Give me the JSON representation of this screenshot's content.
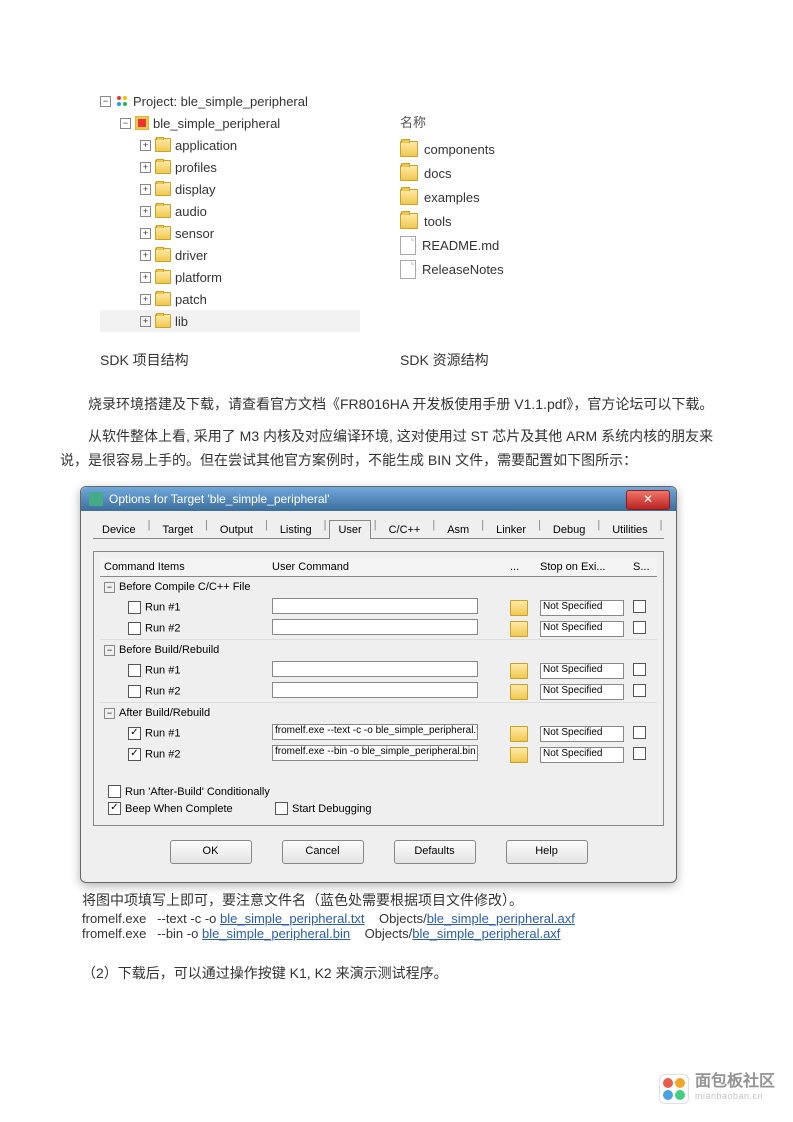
{
  "tree": {
    "root_label": "Project: ble_simple_peripheral",
    "target_label": "ble_simple_peripheral",
    "folders": [
      "application",
      "profiles",
      "display",
      "audio",
      "sensor",
      "driver",
      "platform",
      "patch",
      "lib"
    ]
  },
  "file_list": {
    "header": "名称",
    "folders": [
      "components",
      "docs",
      "examples",
      "tools"
    ],
    "files": [
      "README.md",
      "ReleaseNotes"
    ]
  },
  "captions": {
    "left": "SDK 项目结构",
    "right": "SDK 资源结构"
  },
  "paragraphs": {
    "p1": "烧录环境搭建及下载，请查看官方文档《FR8016HA 开发板使用手册 V1.1.pdf》，官方论坛可以下载。",
    "p2": "从软件整体上看, 采用了 M3 内核及对应编译环境, 这对使用过 ST 芯片及其他 ARM 系统内核的朋友来说，是很容易上手的。但在尝试其他官方案例时，不能生成 BIN 文件，需要配置如下图所示："
  },
  "dialog": {
    "title": "Options for Target 'ble_simple_peripheral'",
    "tabs": [
      "Device",
      "Target",
      "Output",
      "Listing",
      "User",
      "C/C++",
      "Asm",
      "Linker",
      "Debug",
      "Utilities"
    ],
    "active_tab": 4,
    "headers": {
      "items": "Command Items",
      "cmd": "User Command",
      "dots": "...",
      "stop": "Stop on Exi...",
      "s": "S..."
    },
    "groups": [
      {
        "label": "Before Compile C/C++ File",
        "rows": [
          {
            "checked": false,
            "label": "Run #1",
            "cmd": "",
            "stop": "Not Specified"
          },
          {
            "checked": false,
            "label": "Run #2",
            "cmd": "",
            "stop": "Not Specified"
          }
        ]
      },
      {
        "label": "Before Build/Rebuild",
        "rows": [
          {
            "checked": false,
            "label": "Run #1",
            "cmd": "",
            "stop": "Not Specified"
          },
          {
            "checked": false,
            "label": "Run #2",
            "cmd": "",
            "stop": "Not Specified"
          }
        ]
      },
      {
        "label": "After Build/Rebuild",
        "rows": [
          {
            "checked": true,
            "label": "Run #1",
            "cmd": "fromelf.exe  --text  -c -o ble_simple_peripheral.tx...",
            "stop": "Not Specified"
          },
          {
            "checked": true,
            "label": "Run #2",
            "cmd": "fromelf.exe  --bin -o ble_simple_peripheral.bin ...",
            "stop": "Not Specified"
          }
        ]
      }
    ],
    "opts": {
      "run_after": "Run 'After-Build' Conditionally",
      "beep": "Beep When Complete",
      "start_dbg": "Start Debugging"
    },
    "buttons": [
      "OK",
      "Cancel",
      "Defaults",
      "Help"
    ]
  },
  "after_dialog": "将图中项填写上即可，要注意文件名（蓝色处需要根据项目文件修改）。",
  "cmd1": {
    "exe": "fromelf.exe",
    "args": "--text    -c -o",
    "f1": "ble_simple_peripheral.txt",
    "mid": "Objects/",
    "f2": "ble_simple_peripheral.axf"
  },
  "cmd2": {
    "exe": "fromelf.exe",
    "args": "--bin -o",
    "f1": "ble_simple_peripheral.bin",
    "mid": "Objects/",
    "f2": "ble_simple_peripheral.axf"
  },
  "step2": "（2）下载后，可以通过操作按键 K1, K2 来演示测试程序。",
  "watermark": {
    "t1": "面包板社区",
    "t2": "mianbaoban.cn"
  }
}
